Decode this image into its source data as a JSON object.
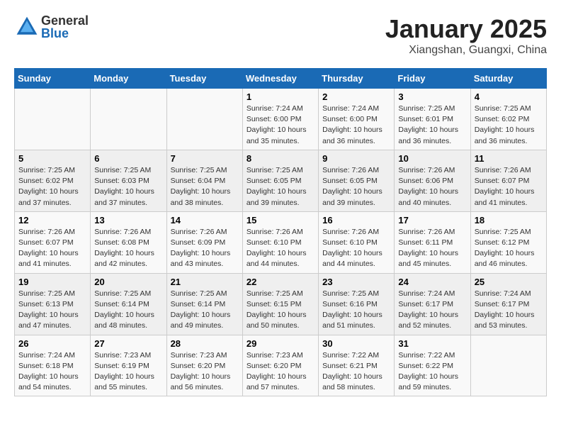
{
  "header": {
    "logo_general": "General",
    "logo_blue": "Blue",
    "title": "January 2025",
    "subtitle": "Xiangshan, Guangxi, China"
  },
  "days_of_week": [
    "Sunday",
    "Monday",
    "Tuesday",
    "Wednesday",
    "Thursday",
    "Friday",
    "Saturday"
  ],
  "weeks": [
    [
      {
        "day": "",
        "info": ""
      },
      {
        "day": "",
        "info": ""
      },
      {
        "day": "",
        "info": ""
      },
      {
        "day": "1",
        "info": "Sunrise: 7:24 AM\nSunset: 6:00 PM\nDaylight: 10 hours\nand 35 minutes."
      },
      {
        "day": "2",
        "info": "Sunrise: 7:24 AM\nSunset: 6:00 PM\nDaylight: 10 hours\nand 36 minutes."
      },
      {
        "day": "3",
        "info": "Sunrise: 7:25 AM\nSunset: 6:01 PM\nDaylight: 10 hours\nand 36 minutes."
      },
      {
        "day": "4",
        "info": "Sunrise: 7:25 AM\nSunset: 6:02 PM\nDaylight: 10 hours\nand 36 minutes."
      }
    ],
    [
      {
        "day": "5",
        "info": "Sunrise: 7:25 AM\nSunset: 6:02 PM\nDaylight: 10 hours\nand 37 minutes."
      },
      {
        "day": "6",
        "info": "Sunrise: 7:25 AM\nSunset: 6:03 PM\nDaylight: 10 hours\nand 37 minutes."
      },
      {
        "day": "7",
        "info": "Sunrise: 7:25 AM\nSunset: 6:04 PM\nDaylight: 10 hours\nand 38 minutes."
      },
      {
        "day": "8",
        "info": "Sunrise: 7:25 AM\nSunset: 6:05 PM\nDaylight: 10 hours\nand 39 minutes."
      },
      {
        "day": "9",
        "info": "Sunrise: 7:26 AM\nSunset: 6:05 PM\nDaylight: 10 hours\nand 39 minutes."
      },
      {
        "day": "10",
        "info": "Sunrise: 7:26 AM\nSunset: 6:06 PM\nDaylight: 10 hours\nand 40 minutes."
      },
      {
        "day": "11",
        "info": "Sunrise: 7:26 AM\nSunset: 6:07 PM\nDaylight: 10 hours\nand 41 minutes."
      }
    ],
    [
      {
        "day": "12",
        "info": "Sunrise: 7:26 AM\nSunset: 6:07 PM\nDaylight: 10 hours\nand 41 minutes."
      },
      {
        "day": "13",
        "info": "Sunrise: 7:26 AM\nSunset: 6:08 PM\nDaylight: 10 hours\nand 42 minutes."
      },
      {
        "day": "14",
        "info": "Sunrise: 7:26 AM\nSunset: 6:09 PM\nDaylight: 10 hours\nand 43 minutes."
      },
      {
        "day": "15",
        "info": "Sunrise: 7:26 AM\nSunset: 6:10 PM\nDaylight: 10 hours\nand 44 minutes."
      },
      {
        "day": "16",
        "info": "Sunrise: 7:26 AM\nSunset: 6:10 PM\nDaylight: 10 hours\nand 44 minutes."
      },
      {
        "day": "17",
        "info": "Sunrise: 7:26 AM\nSunset: 6:11 PM\nDaylight: 10 hours\nand 45 minutes."
      },
      {
        "day": "18",
        "info": "Sunrise: 7:25 AM\nSunset: 6:12 PM\nDaylight: 10 hours\nand 46 minutes."
      }
    ],
    [
      {
        "day": "19",
        "info": "Sunrise: 7:25 AM\nSunset: 6:13 PM\nDaylight: 10 hours\nand 47 minutes."
      },
      {
        "day": "20",
        "info": "Sunrise: 7:25 AM\nSunset: 6:14 PM\nDaylight: 10 hours\nand 48 minutes."
      },
      {
        "day": "21",
        "info": "Sunrise: 7:25 AM\nSunset: 6:14 PM\nDaylight: 10 hours\nand 49 minutes."
      },
      {
        "day": "22",
        "info": "Sunrise: 7:25 AM\nSunset: 6:15 PM\nDaylight: 10 hours\nand 50 minutes."
      },
      {
        "day": "23",
        "info": "Sunrise: 7:25 AM\nSunset: 6:16 PM\nDaylight: 10 hours\nand 51 minutes."
      },
      {
        "day": "24",
        "info": "Sunrise: 7:24 AM\nSunset: 6:17 PM\nDaylight: 10 hours\nand 52 minutes."
      },
      {
        "day": "25",
        "info": "Sunrise: 7:24 AM\nSunset: 6:17 PM\nDaylight: 10 hours\nand 53 minutes."
      }
    ],
    [
      {
        "day": "26",
        "info": "Sunrise: 7:24 AM\nSunset: 6:18 PM\nDaylight: 10 hours\nand 54 minutes."
      },
      {
        "day": "27",
        "info": "Sunrise: 7:23 AM\nSunset: 6:19 PM\nDaylight: 10 hours\nand 55 minutes."
      },
      {
        "day": "28",
        "info": "Sunrise: 7:23 AM\nSunset: 6:20 PM\nDaylight: 10 hours\nand 56 minutes."
      },
      {
        "day": "29",
        "info": "Sunrise: 7:23 AM\nSunset: 6:20 PM\nDaylight: 10 hours\nand 57 minutes."
      },
      {
        "day": "30",
        "info": "Sunrise: 7:22 AM\nSunset: 6:21 PM\nDaylight: 10 hours\nand 58 minutes."
      },
      {
        "day": "31",
        "info": "Sunrise: 7:22 AM\nSunset: 6:22 PM\nDaylight: 10 hours\nand 59 minutes."
      },
      {
        "day": "",
        "info": ""
      }
    ]
  ]
}
